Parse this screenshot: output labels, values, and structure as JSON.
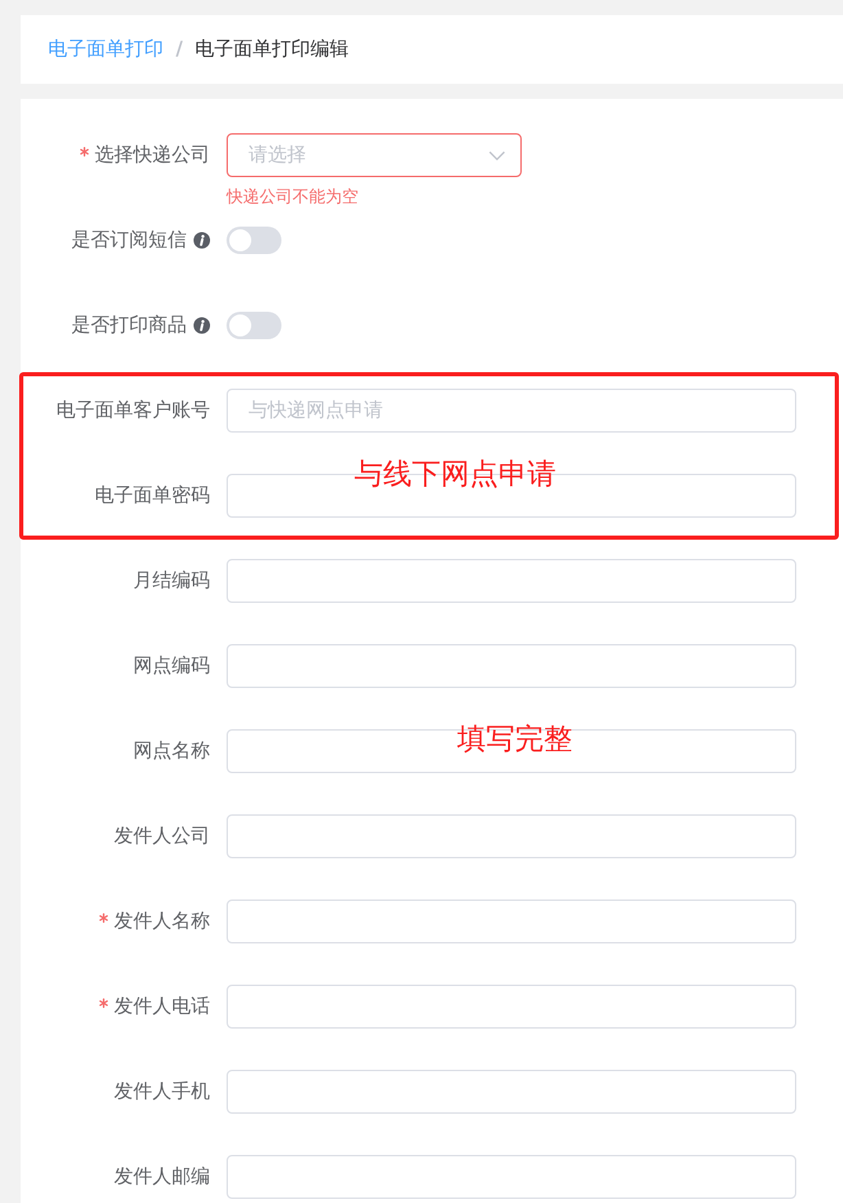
{
  "breadcrumb": {
    "items": [
      {
        "label": "电子面单打印",
        "kind": "link"
      },
      {
        "label": "电子面单打印编辑",
        "kind": "current"
      }
    ],
    "separator": "/"
  },
  "form": {
    "fields": [
      {
        "kind": "select",
        "label": "选择快递公司",
        "required": true,
        "placeholder": "请选择",
        "error": "快递公司不能为空"
      },
      {
        "kind": "switch",
        "label": "是否订阅短信",
        "required": false,
        "info": true,
        "on": false
      },
      {
        "kind": "switch",
        "label": "是否打印商品",
        "required": false,
        "info": true,
        "on": false
      },
      {
        "kind": "input",
        "label": "电子面单客户账号",
        "required": false,
        "placeholder": "与快递网点申请"
      },
      {
        "kind": "input",
        "label": "电子面单密码",
        "required": false
      },
      {
        "kind": "input",
        "label": "月结编码",
        "required": false
      },
      {
        "kind": "input",
        "label": "网点编码",
        "required": false
      },
      {
        "kind": "input",
        "label": "网点名称",
        "required": false
      },
      {
        "kind": "input",
        "label": "发件人公司",
        "required": false
      },
      {
        "kind": "input",
        "label": "发件人名称",
        "required": true
      },
      {
        "kind": "input",
        "label": "发件人电话",
        "required": true
      },
      {
        "kind": "input",
        "label": "发件人手机",
        "required": false
      },
      {
        "kind": "input",
        "label": "发件人邮编",
        "required": false
      }
    ]
  },
  "annotations": [
    {
      "kind": "frame",
      "text": "与线下网点申请"
    },
    {
      "kind": "note",
      "text": "填写完整"
    }
  ]
}
